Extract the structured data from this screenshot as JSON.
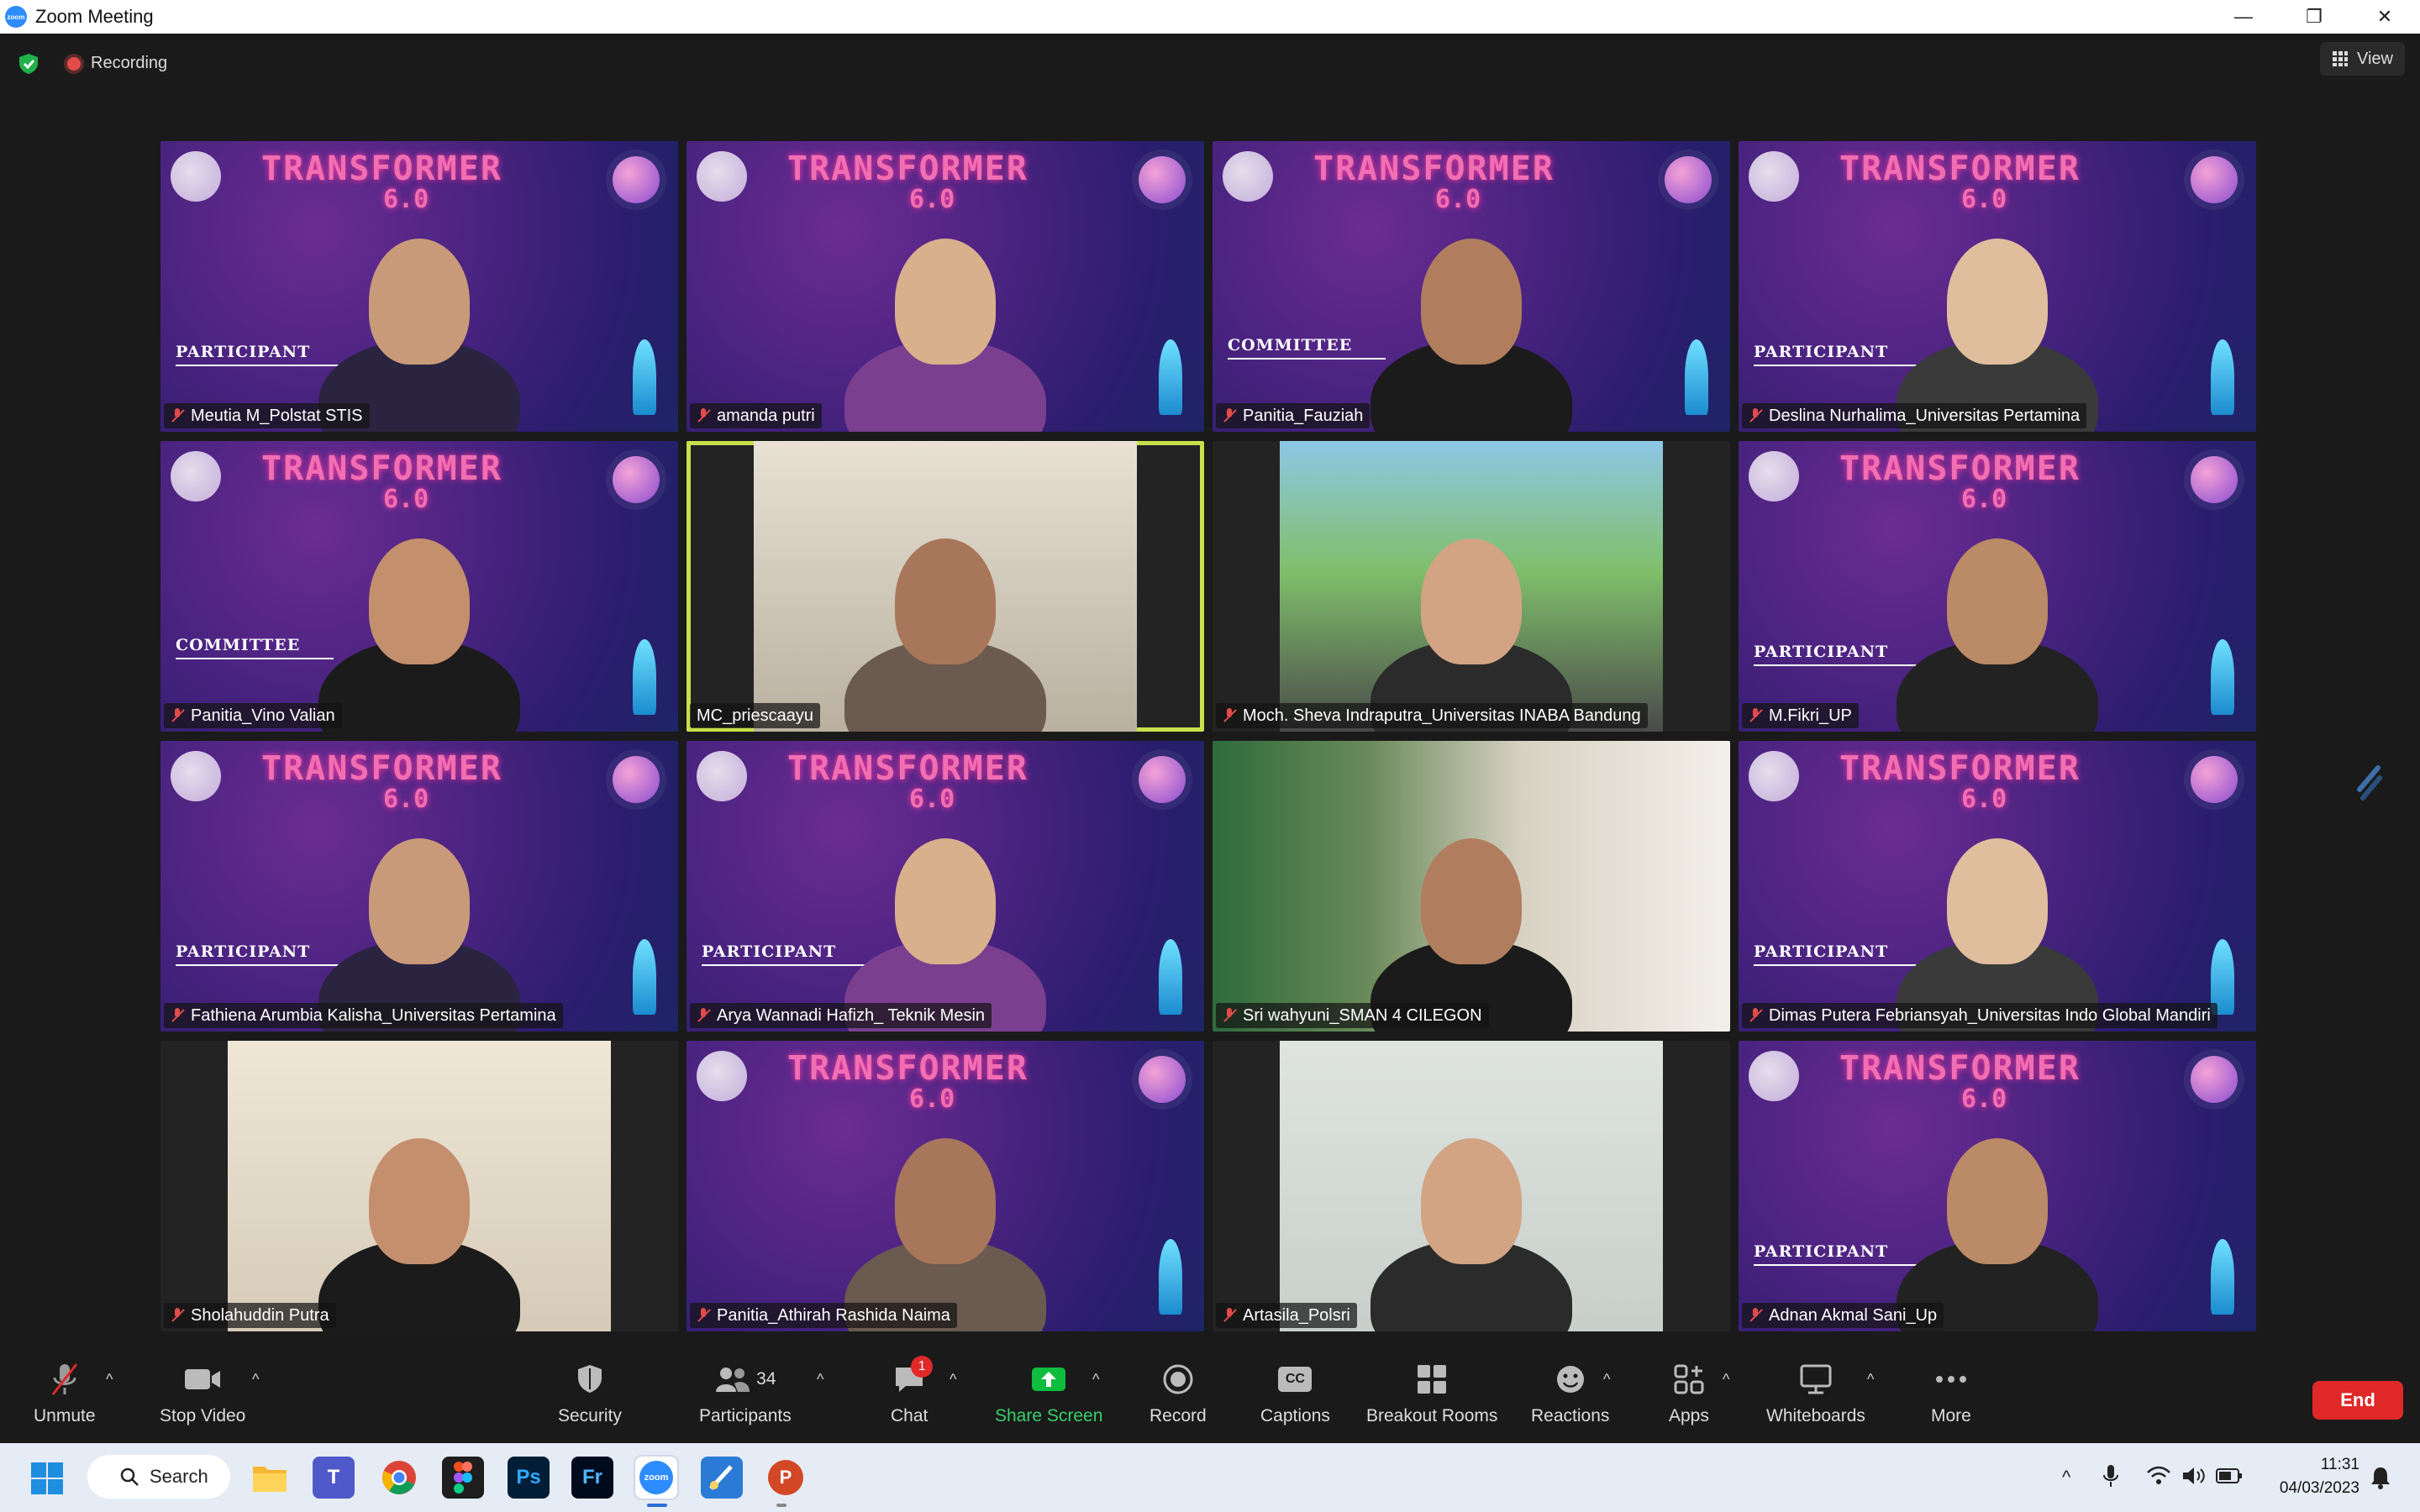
{
  "window": {
    "title": "Zoom Meeting",
    "logo_text": "zoom",
    "minimize": "—",
    "restore": "❐",
    "close": "✕"
  },
  "meeting": {
    "recording_label": "Recording",
    "view_label": "View"
  },
  "tiles": [
    {
      "name": "Meutia M_Polstat STIS",
      "bg": "space",
      "role": "PARTICIPANT",
      "muted": true
    },
    {
      "name": "amanda putri",
      "bg": "space",
      "role": "",
      "muted": true
    },
    {
      "name": "Panitia_Fauziah",
      "bg": "space",
      "role": "COMMITTEE",
      "muted": true
    },
    {
      "name": "Deslina Nurhalima_Universitas Pertamina",
      "bg": "space",
      "role": "PARTICIPANT",
      "muted": true
    },
    {
      "name": "Panitia_Vino Valian",
      "bg": "space",
      "role": "COMMITTEE",
      "muted": true
    },
    {
      "name": "MC_priescaayu",
      "bg": "camera",
      "role": "",
      "muted": false,
      "active": true
    },
    {
      "name": "Moch. Sheva Indraputra_Universitas INABA Bandung",
      "bg": "camera",
      "role": "",
      "muted": true
    },
    {
      "name": "M.Fikri_UP",
      "bg": "space",
      "role": "PARTICIPANT",
      "muted": true
    },
    {
      "name": "Fathiena Arumbia Kalisha_Universitas Pertamina",
      "bg": "space",
      "role": "PARTICIPANT",
      "muted": true
    },
    {
      "name": "Arya Wannadi Hafizh_ Teknik Mesin",
      "bg": "space",
      "role": "PARTICIPANT",
      "muted": true
    },
    {
      "name": "Sri wahyuni_SMAN 4 CILEGON",
      "bg": "camera",
      "role": "",
      "muted": true
    },
    {
      "name": "Dimas Putera Febriansyah_Universitas Indo Global Mandiri",
      "bg": "space",
      "role": "PARTICIPANT",
      "muted": true
    },
    {
      "name": "Sholahuddin Putra",
      "bg": "camera",
      "role": "",
      "muted": true
    },
    {
      "name": "Panitia_Athirah Rashida Naima",
      "bg": "space",
      "role": "",
      "muted": true
    },
    {
      "name": "Artasila_Polsri",
      "bg": "camera",
      "role": "",
      "muted": true
    },
    {
      "name": "Adnan Akmal Sani_Up",
      "bg": "space",
      "role": "PARTICIPANT",
      "muted": true
    }
  ],
  "branding": {
    "title": "TRANSFORMER",
    "version": "6.0"
  },
  "toolbar": {
    "unmute": "Unmute",
    "stop_video": "Stop Video",
    "security": "Security",
    "participants": "Participants",
    "participant_count": "34",
    "chat": "Chat",
    "chat_badge": "1",
    "share_screen": "Share Screen",
    "record": "Record",
    "captions": "Captions",
    "breakout_rooms": "Breakout Rooms",
    "reactions": "Reactions",
    "apps": "Apps",
    "whiteboards": "Whiteboards",
    "more": "More",
    "end": "End",
    "captions_glyph": "CC"
  },
  "taskbar": {
    "search_label": "Search",
    "apps": [
      "File Explorer",
      "Teams",
      "Chrome",
      "Figma",
      "Ps",
      "Fr",
      "zoom",
      "Paint",
      "PowerPoint"
    ],
    "time": "11:31",
    "date": "04/03/2023"
  },
  "colors": {
    "accent_green": "#00c853",
    "end_red": "#e02828",
    "active_border": "#c8e04a",
    "space_purple": "#4a2380"
  }
}
